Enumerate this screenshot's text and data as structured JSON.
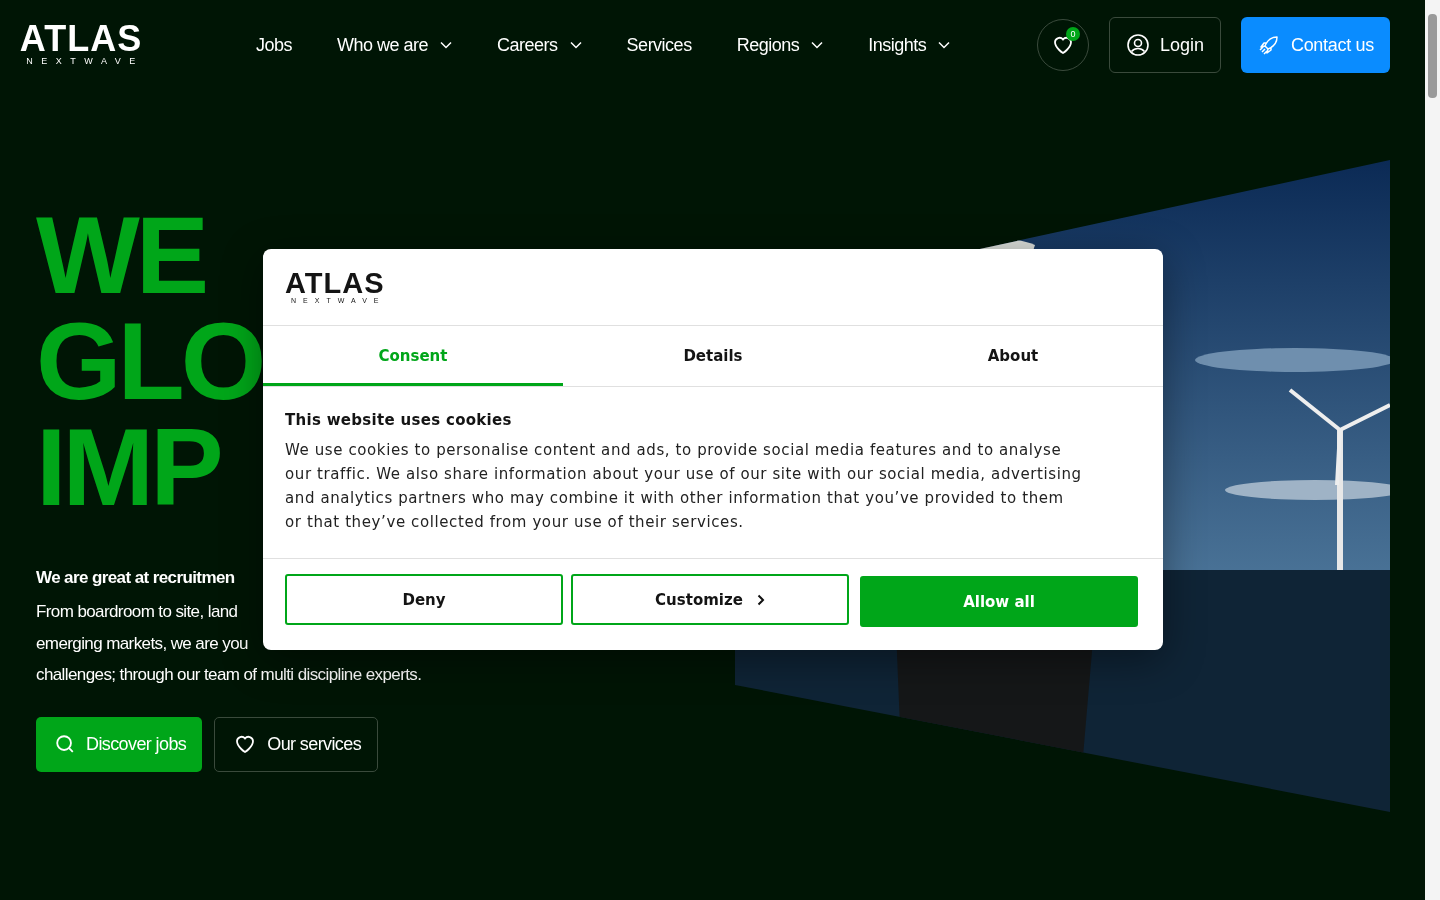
{
  "header": {
    "logo": {
      "name": "ATLAS",
      "tagline": "NEXTWAVE"
    },
    "nav": [
      {
        "label": "Jobs",
        "has_menu": false
      },
      {
        "label": "Who we are",
        "has_menu": true
      },
      {
        "label": "Careers",
        "has_menu": true
      },
      {
        "label": "Services",
        "has_menu": false
      },
      {
        "label": "Regions",
        "has_menu": true
      },
      {
        "label": "Insights",
        "has_menu": true
      }
    ],
    "favorites_count": "0",
    "login": "Login",
    "contact": "Contact us"
  },
  "hero": {
    "headline": [
      "WE",
      "GLO",
      "IMP"
    ],
    "lead": "We are great at recruitmen",
    "body": [
      "From boardroom to site, land",
      "emerging markets, we are you",
      "challenges; through our team of multi discipline experts."
    ],
    "buttons": [
      {
        "kind": "primary",
        "label": "Discover jobs"
      },
      {
        "kind": "outline",
        "label": "Our services"
      }
    ]
  },
  "cookie_dialog": {
    "logo": {
      "name": "ATLAS",
      "tagline": "NEXTWAVE"
    },
    "tabs": [
      {
        "label": "Consent",
        "selected": true
      },
      {
        "label": "Details",
        "selected": false
      },
      {
        "label": "About",
        "selected": false
      }
    ],
    "title": "This website uses cookies",
    "text": "We use cookies to personalise content and ads, to provide social media features and to analyse our traffic. We also share information about your use of our site with our social media, advertising and analytics partners who may combine it with other information that you’ve provided to them or that they’ve collected from your use of their services.",
    "buttons": [
      {
        "kind": "outline",
        "label": "Deny"
      },
      {
        "kind": "outline-chevron",
        "label": "Customize"
      },
      {
        "kind": "filled",
        "label": "Allow all"
      }
    ]
  }
}
